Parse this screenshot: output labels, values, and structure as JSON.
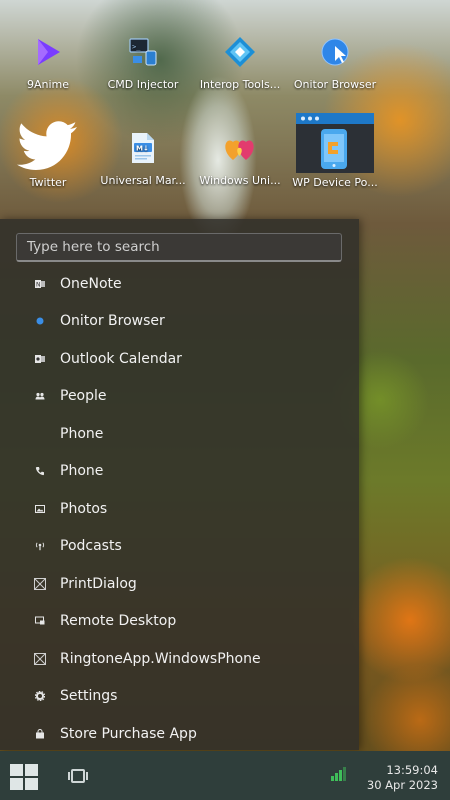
{
  "desktop": {
    "icons": [
      {
        "label": "9Anime",
        "icon": "play-triangle-icon",
        "color": "#7a3cff"
      },
      {
        "label": "CMD Injector",
        "icon": "cmd-injector-icon",
        "color": "#4a90d9"
      },
      {
        "label": "Interop Tools...",
        "icon": "interop-tools-icon",
        "color": "#2aa6e0"
      },
      {
        "label": "Onitor Browser",
        "icon": "globe-cursor-icon",
        "color": "#3a8ee6"
      },
      {
        "label": "Twitter",
        "icon": "twitter-bird-icon",
        "color": "#ffffff"
      },
      {
        "label": "Universal Mar...",
        "icon": "markdown-file-icon",
        "color": "#4aa3df"
      },
      {
        "label": "Windows Uni...",
        "icon": "hearts-icon",
        "color": "#f0a030"
      },
      {
        "label": "WP Device Po...",
        "icon": "phone-window-icon",
        "color": "#1e78c8"
      }
    ]
  },
  "start_menu": {
    "search_placeholder": "Type here to search",
    "apps": [
      {
        "label": "OneNote",
        "icon": "onenote-icon"
      },
      {
        "label": "Onitor Browser",
        "icon": "blue-dot-icon"
      },
      {
        "label": "Outlook Calendar",
        "icon": "outlook-icon"
      },
      {
        "label": "People",
        "icon": "people-icon"
      },
      {
        "label": "Phone",
        "icon": ""
      },
      {
        "label": "Phone",
        "icon": "phone-handset-icon"
      },
      {
        "label": "Photos",
        "icon": "photo-icon"
      },
      {
        "label": "Podcasts",
        "icon": "podcast-icon"
      },
      {
        "label": "PrintDialog",
        "icon": "placeholder-box-icon"
      },
      {
        "label": "Remote Desktop",
        "icon": "remote-desktop-icon"
      },
      {
        "label": "RingtoneApp.WindowsPhone",
        "icon": "placeholder-box-icon"
      },
      {
        "label": "Settings",
        "icon": "gear-icon"
      },
      {
        "label": "Store Purchase App",
        "icon": "store-bag-icon"
      }
    ]
  },
  "taskbar": {
    "time": "13:59:04",
    "date": "30 Apr 2023"
  }
}
